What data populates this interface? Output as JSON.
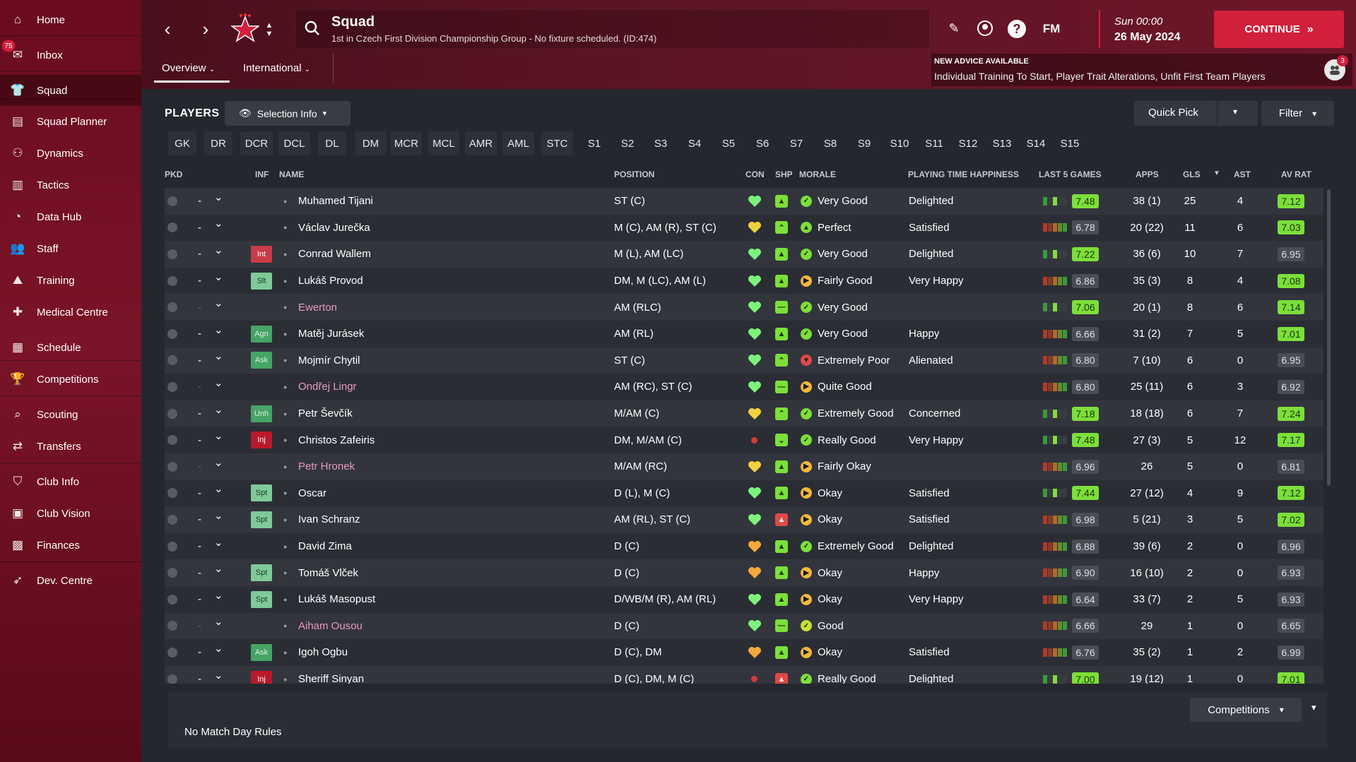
{
  "sidebar": {
    "items": [
      {
        "label": "Home",
        "icon": "home-icon"
      },
      {
        "label": "Inbox",
        "icon": "inbox-icon",
        "badge": "75"
      },
      {
        "label": "Squad",
        "icon": "squad-icon",
        "active": true
      },
      {
        "label": "Squad Planner",
        "icon": "squad-planner-icon"
      },
      {
        "label": "Dynamics",
        "icon": "dynamics-icon"
      },
      {
        "label": "Tactics",
        "icon": "tactics-icon"
      },
      {
        "label": "Data Hub",
        "icon": "data-hub-icon"
      },
      {
        "label": "Staff",
        "icon": "staff-icon"
      },
      {
        "label": "Training",
        "icon": "training-icon"
      },
      {
        "label": "Medical Centre",
        "icon": "medical-icon"
      },
      {
        "label": "Schedule",
        "icon": "schedule-icon"
      },
      {
        "label": "Competitions",
        "icon": "trophy-icon"
      },
      {
        "label": "Scouting",
        "icon": "scouting-icon"
      },
      {
        "label": "Transfers",
        "icon": "transfers-icon"
      },
      {
        "label": "Club Info",
        "icon": "club-info-icon"
      },
      {
        "label": "Club Vision",
        "icon": "club-vision-icon"
      },
      {
        "label": "Finances",
        "icon": "finances-icon"
      },
      {
        "label": "Dev. Centre",
        "icon": "dev-centre-icon"
      }
    ]
  },
  "header": {
    "title": "Squad",
    "subtitle": "1st in Czech First Division Championship Group - No fixture scheduled. (ID:474)",
    "day": "Sun 00:00",
    "date": "26 May 2024",
    "continue_label": "CONTINUE",
    "fm_label": "FM",
    "tabs": [
      "Overview",
      "International"
    ],
    "advice_title": "NEW ADVICE AVAILABLE",
    "advice_text": "Individual Training To Start, Player Trait Alterations, Unfit First Team Players",
    "advice_badge": "3"
  },
  "players_section": {
    "title": "PLAYERS",
    "selection_info": "Selection Info",
    "quick_pick": "Quick Pick",
    "filter": "Filter"
  },
  "position_filters": [
    "GK",
    "DR",
    "DCR",
    "DCL",
    "DL",
    "DM",
    "MCR",
    "MCL",
    "AMR",
    "AML",
    "STC",
    "S1",
    "S2",
    "S3",
    "S4",
    "S5",
    "S6",
    "S7",
    "S8",
    "S9",
    "S10",
    "S11",
    "S12",
    "S13",
    "S14",
    "S15"
  ],
  "columns": {
    "pkd": "PKD",
    "inf": "INF",
    "name": "NAME",
    "position": "POSITION",
    "con": "CON",
    "shp": "SHP",
    "morale": "MORALE",
    "pth": "PLAYING TIME HAPPINESS",
    "last5": "LAST 5 GAMES",
    "apps": "APPS",
    "gls": "GLS",
    "ast": "AST",
    "avrat": "AV RAT"
  },
  "players": [
    {
      "pkd": "-",
      "inf": "",
      "name": "Muhamed Tijani",
      "loan": false,
      "position": "ST (C)",
      "con": "green",
      "shp": "green",
      "morale": "Very Good",
      "mor": "good",
      "pth": "Delighted",
      "last5": "7.48",
      "last5_hi": true,
      "apps": "38 (1)",
      "gls": "25",
      "ast": "4",
      "avrat": "7.12",
      "avrat_hi": true
    },
    {
      "pkd": "-",
      "inf": "",
      "name": "Václav Jurečka",
      "loan": false,
      "position": "M (C), AM (R), ST (C)",
      "con": "yellow",
      "shp": "green-up",
      "morale": "Perfect",
      "mor": "perfect",
      "pth": "Satisfied",
      "last5": "6.78",
      "last5_hi": false,
      "apps": "20 (22)",
      "gls": "11",
      "ast": "6",
      "avrat": "7.03",
      "avrat_hi": true
    },
    {
      "pkd": "-",
      "inf": "Int",
      "infc": "red",
      "name": "Conrad Wallem",
      "loan": false,
      "position": "M (L), AM (LC)",
      "con": "green",
      "shp": "green",
      "morale": "Very Good",
      "mor": "good",
      "pth": "Delighted",
      "last5": "7.22",
      "last5_hi": true,
      "apps": "36 (6)",
      "gls": "10",
      "ast": "7",
      "avrat": "6.95",
      "avrat_hi": false
    },
    {
      "pkd": "-",
      "inf": "Slt",
      "infc": "green",
      "name": "Lukáš Provod",
      "loan": false,
      "position": "DM, M (LC), AM (L)",
      "con": "green",
      "shp": "green",
      "morale": "Fairly Good",
      "mor": "ok",
      "pth": "Very Happy",
      "last5": "6.86",
      "last5_hi": false,
      "apps": "35 (3)",
      "gls": "8",
      "ast": "4",
      "avrat": "7.08",
      "avrat_hi": true
    },
    {
      "pkd": "-",
      "inf": "",
      "name": "Ewerton",
      "loan": true,
      "position": "AM (RLC)",
      "con": "green",
      "shp": "neutral",
      "morale": "Very Good",
      "mor": "good",
      "pth": "",
      "last5": "7.06",
      "last5_hi": true,
      "apps": "20 (1)",
      "gls": "8",
      "ast": "6",
      "avrat": "7.14",
      "avrat_hi": true
    },
    {
      "pkd": "-",
      "inf": "Agn",
      "infc": "greendark",
      "name": "Matěj Jurásek",
      "loan": false,
      "position": "AM (RL)",
      "con": "green",
      "shp": "green",
      "morale": "Very Good",
      "mor": "good",
      "pth": "Happy",
      "last5": "6.66",
      "last5_hi": false,
      "apps": "31 (2)",
      "gls": "7",
      "ast": "5",
      "avrat": "7.01",
      "avrat_hi": true
    },
    {
      "pkd": "-",
      "inf": "Ask",
      "infc": "greendark",
      "name": "Mojmír Chytil",
      "loan": false,
      "position": "ST (C)",
      "con": "green",
      "shp": "green-up",
      "morale": "Extremely Poor",
      "mor": "bad",
      "pth": "Alienated",
      "last5": "6.80",
      "last5_hi": false,
      "apps": "7 (10)",
      "gls": "6",
      "ast": "0",
      "avrat": "6.95",
      "avrat_hi": false
    },
    {
      "pkd": "-",
      "inf": "",
      "name": "Ondřej Lingr",
      "loan": true,
      "position": "AM (RC), ST (C)",
      "con": "green",
      "shp": "neutral",
      "morale": "Quite Good",
      "mor": "ok",
      "pth": "",
      "last5": "6.80",
      "last5_hi": false,
      "apps": "25 (11)",
      "gls": "6",
      "ast": "3",
      "avrat": "6.92",
      "avrat_hi": false
    },
    {
      "pkd": "-",
      "inf": "Unh",
      "infc": "greendark",
      "name": "Petr Ševčík",
      "loan": false,
      "position": "M/AM (C)",
      "con": "yellow",
      "shp": "green-up",
      "morale": "Extremely Good",
      "mor": "good",
      "pth": "Concerned",
      "last5": "7.18",
      "last5_hi": true,
      "apps": "18 (18)",
      "gls": "6",
      "ast": "7",
      "avrat": "7.24",
      "avrat_hi": true
    },
    {
      "pkd": "-",
      "inf": "Inj",
      "infc": "darkred",
      "name": "Christos Zafeiris",
      "loan": false,
      "position": "DM, M/AM (C)",
      "con": "red",
      "shp": "green-down",
      "morale": "Really Good",
      "mor": "good",
      "pth": "Very Happy",
      "last5": "7.48",
      "last5_hi": true,
      "apps": "27 (3)",
      "gls": "5",
      "ast": "12",
      "avrat": "7.17",
      "avrat_hi": true
    },
    {
      "pkd": "-",
      "inf": "",
      "name": "Petr Hronek",
      "loan": true,
      "position": "M/AM (RC)",
      "con": "yellow",
      "shp": "green",
      "morale": "Fairly Okay",
      "mor": "ok",
      "pth": "",
      "last5": "6.96",
      "last5_hi": false,
      "apps": "26",
      "gls": "5",
      "ast": "0",
      "avrat": "6.81",
      "avrat_hi": false
    },
    {
      "pkd": "-",
      "inf": "Spt",
      "infc": "green",
      "name": "Oscar",
      "loan": false,
      "position": "D (L), M (C)",
      "con": "green",
      "shp": "green",
      "morale": "Okay",
      "mor": "ok",
      "pth": "Satisfied",
      "last5": "7.44",
      "last5_hi": true,
      "apps": "27 (12)",
      "gls": "4",
      "ast": "9",
      "avrat": "7.12",
      "avrat_hi": true
    },
    {
      "pkd": "-",
      "inf": "Spt",
      "infc": "green",
      "name": "Ivan Schranz",
      "loan": false,
      "position": "AM (RL), ST (C)",
      "con": "green",
      "shp": "red",
      "morale": "Okay",
      "mor": "ok",
      "pth": "Satisfied",
      "last5": "6.98",
      "last5_hi": false,
      "apps": "5 (21)",
      "gls": "3",
      "ast": "5",
      "avrat": "7.02",
      "avrat_hi": true
    },
    {
      "pkd": "-",
      "inf": "",
      "name": "David Zima",
      "loan": false,
      "position": "D (C)",
      "con": "orange",
      "shp": "green",
      "morale": "Extremely Good",
      "mor": "good",
      "pth": "Delighted",
      "last5": "6.88",
      "last5_hi": false,
      "apps": "39 (6)",
      "gls": "2",
      "ast": "0",
      "avrat": "6.96",
      "avrat_hi": false
    },
    {
      "pkd": "-",
      "inf": "Spt",
      "infc": "green",
      "name": "Tomáš Vlček",
      "loan": false,
      "position": "D (C)",
      "con": "orange",
      "shp": "green",
      "morale": "Okay",
      "mor": "ok",
      "pth": "Happy",
      "last5": "6.90",
      "last5_hi": false,
      "apps": "16 (10)",
      "gls": "2",
      "ast": "0",
      "avrat": "6.93",
      "avrat_hi": false
    },
    {
      "pkd": "-",
      "inf": "Spt",
      "infc": "green",
      "name": "Lukáš Masopust",
      "loan": false,
      "position": "D/WB/M (R), AM (RL)",
      "con": "green",
      "shp": "green",
      "morale": "Okay",
      "mor": "ok",
      "pth": "Very Happy",
      "last5": "6.64",
      "last5_hi": false,
      "apps": "33 (7)",
      "gls": "2",
      "ast": "5",
      "avrat": "6.93",
      "avrat_hi": false
    },
    {
      "pkd": "-",
      "inf": "",
      "name": "Aiham Ousou",
      "loan": true,
      "position": "D (C)",
      "con": "green",
      "shp": "neutral",
      "morale": "Good",
      "mor": "okgood",
      "pth": "",
      "last5": "6.66",
      "last5_hi": false,
      "apps": "29",
      "gls": "1",
      "ast": "0",
      "avrat": "6.65",
      "avrat_hi": false
    },
    {
      "pkd": "-",
      "inf": "Ask",
      "infc": "greendark",
      "name": "Igoh Ogbu",
      "loan": false,
      "position": "D (C), DM",
      "con": "orange",
      "shp": "green",
      "morale": "Okay",
      "mor": "ok",
      "pth": "Satisfied",
      "last5": "6.76",
      "last5_hi": false,
      "apps": "35 (2)",
      "gls": "1",
      "ast": "2",
      "avrat": "6.99",
      "avrat_hi": false
    },
    {
      "pkd": "-",
      "inf": "Inj",
      "infc": "darkred",
      "name": "Sheriff Sinyan",
      "loan": false,
      "position": "D (C), DM, M (C)",
      "con": "red",
      "shp": "red",
      "morale": "Really Good",
      "mor": "good",
      "pth": "Delighted",
      "last5": "7.00",
      "last5_hi": true,
      "apps": "19 (12)",
      "gls": "1",
      "ast": "0",
      "avrat": "7.01",
      "avrat_hi": true
    }
  ],
  "footer": {
    "no_rules": "No Match Day Rules",
    "competitions": "Competitions"
  },
  "colors": {
    "accent": "#d21f3c",
    "rating_green": "#7cdf3a",
    "sidebar": "#6a0c1e"
  }
}
